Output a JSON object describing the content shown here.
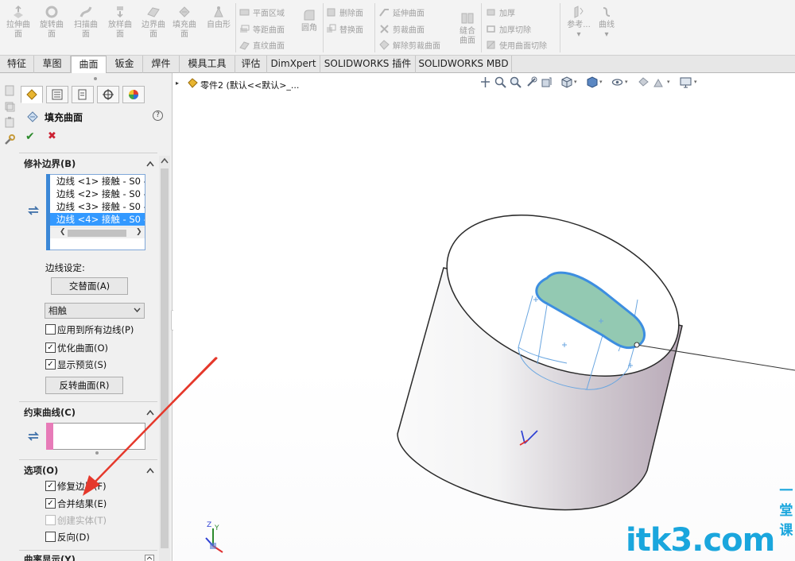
{
  "ribbon": {
    "big_buttons": [
      {
        "name": "extrude",
        "line1": "拉伸曲",
        "line2": "面"
      },
      {
        "name": "revolve",
        "line1": "旋转曲",
        "line2": "面"
      },
      {
        "name": "sweep",
        "line1": "扫描曲",
        "line2": "面"
      },
      {
        "name": "loft",
        "line1": "放样曲",
        "line2": "面"
      },
      {
        "name": "boundary",
        "line1": "边界曲",
        "line2": "面"
      },
      {
        "name": "fill",
        "line1": "填充曲",
        "line2": "面"
      },
      {
        "name": "freeform",
        "line1": "自由形",
        "line2": ""
      }
    ],
    "group1": [
      "平面区域",
      "等距曲面",
      "直纹曲面"
    ],
    "fillet": "圆角",
    "group2": [
      "删除面",
      "替换面"
    ],
    "group3": [
      "延伸曲面",
      "剪裁曲面",
      "解除剪裁曲面"
    ],
    "knit": {
      "line1": "缝合",
      "line2": "曲面"
    },
    "group4": [
      "加厚",
      "加厚切除",
      "使用曲面切除"
    ],
    "reference": "参考...",
    "curves": "曲线",
    "dd": "▾"
  },
  "tabs": [
    "特征",
    "草图",
    "曲面",
    "钣金",
    "焊件",
    "模具工具",
    "评估",
    "DimXpert",
    "SOLIDWORKS 插件",
    "SOLIDWORKS MBD"
  ],
  "panel": {
    "title": "填充曲面",
    "help": "?",
    "ok": "✔",
    "cancel": "✖",
    "patch": {
      "heading": "修补边界(B)",
      "edges": [
        "边线 <1> 接触 - S0 -",
        "边线 <2> 接触 - S0 -",
        "边线 <3> 接触 - S0 -",
        "边线 <4> 接触 - S0 -"
      ],
      "scroll_left": "❮",
      "scroll_right": "❯",
      "edge_setting_label": "边线设定:",
      "alternate_face_btn": "交替面(A)",
      "condition": "相触",
      "apply_all": "应用到所有边线(P)",
      "optimize": "优化曲面(O)",
      "preview": "显示预览(S)",
      "reverse_btn": "反转曲面(R)"
    },
    "constraint": {
      "heading": "约束曲线(C)"
    },
    "options": {
      "heading": "选项(O)",
      "fix_boundary": "修复边界(F)",
      "merge_result": "合并结果(E)",
      "create_solid": "创建实体(T)",
      "reverse": "反向(D)"
    },
    "curvature": {
      "heading": "曲率显示(Y)"
    },
    "check": "✓"
  },
  "viewport": {
    "tree_label": "零件2 (默认<<默认>_...",
    "tree_arrow": "▸",
    "axis_y": "Y",
    "axis_z": "Z"
  },
  "watermark": {
    "main": "itk3.com",
    "side": "一堂课"
  },
  "colors": {
    "accent": "#3399ff",
    "watermark": "#1aa6dd",
    "constraint": "#e77bb8",
    "selection_face": "#8fc6ad"
  }
}
